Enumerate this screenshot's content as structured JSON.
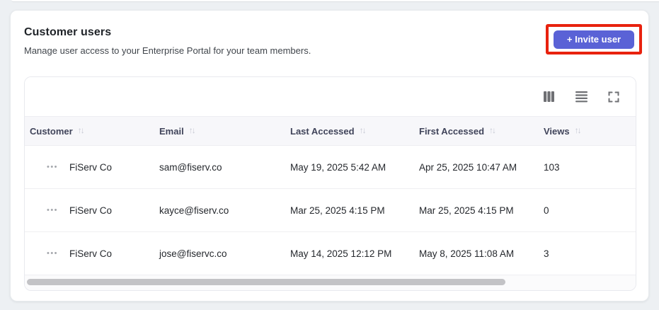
{
  "page": {
    "title": "Customer users",
    "subtitle": "Manage user access to your Enterprise Portal for your team members."
  },
  "actions": {
    "invite_label": "+ Invite user"
  },
  "colors": {
    "accent_button": "#5a62d6",
    "annotation_highlight": "#e8220e",
    "header_row_bg": "#f7f7fa",
    "page_bg": "#edf0f3"
  },
  "toolbar": {
    "icons": [
      "columns-icon",
      "row-height-icon",
      "fullscreen-icon"
    ]
  },
  "table": {
    "sort_glyph": "↑↓",
    "row_actions_glyph": "•••",
    "columns": [
      "Customer",
      "Email",
      "Last Accessed",
      "First Accessed",
      "Views"
    ],
    "rows": [
      {
        "customer": "FiServ Co",
        "email": "sam@fiserv.co",
        "last_accessed": "May 19, 2025 5:42 AM",
        "first_accessed": "Apr 25, 2025 10:47 AM",
        "views": "103"
      },
      {
        "customer": "FiServ Co",
        "email": "kayce@fiserv.co",
        "last_accessed": "Mar 25, 2025 4:15 PM",
        "first_accessed": "Mar 25, 2025 4:15 PM",
        "views": "0"
      },
      {
        "customer": "FiServ Co",
        "email": "jose@fiservc.co",
        "last_accessed": "May 14, 2025 12:12 PM",
        "first_accessed": "May 8, 2025 11:08 AM",
        "views": "3"
      }
    ]
  }
}
